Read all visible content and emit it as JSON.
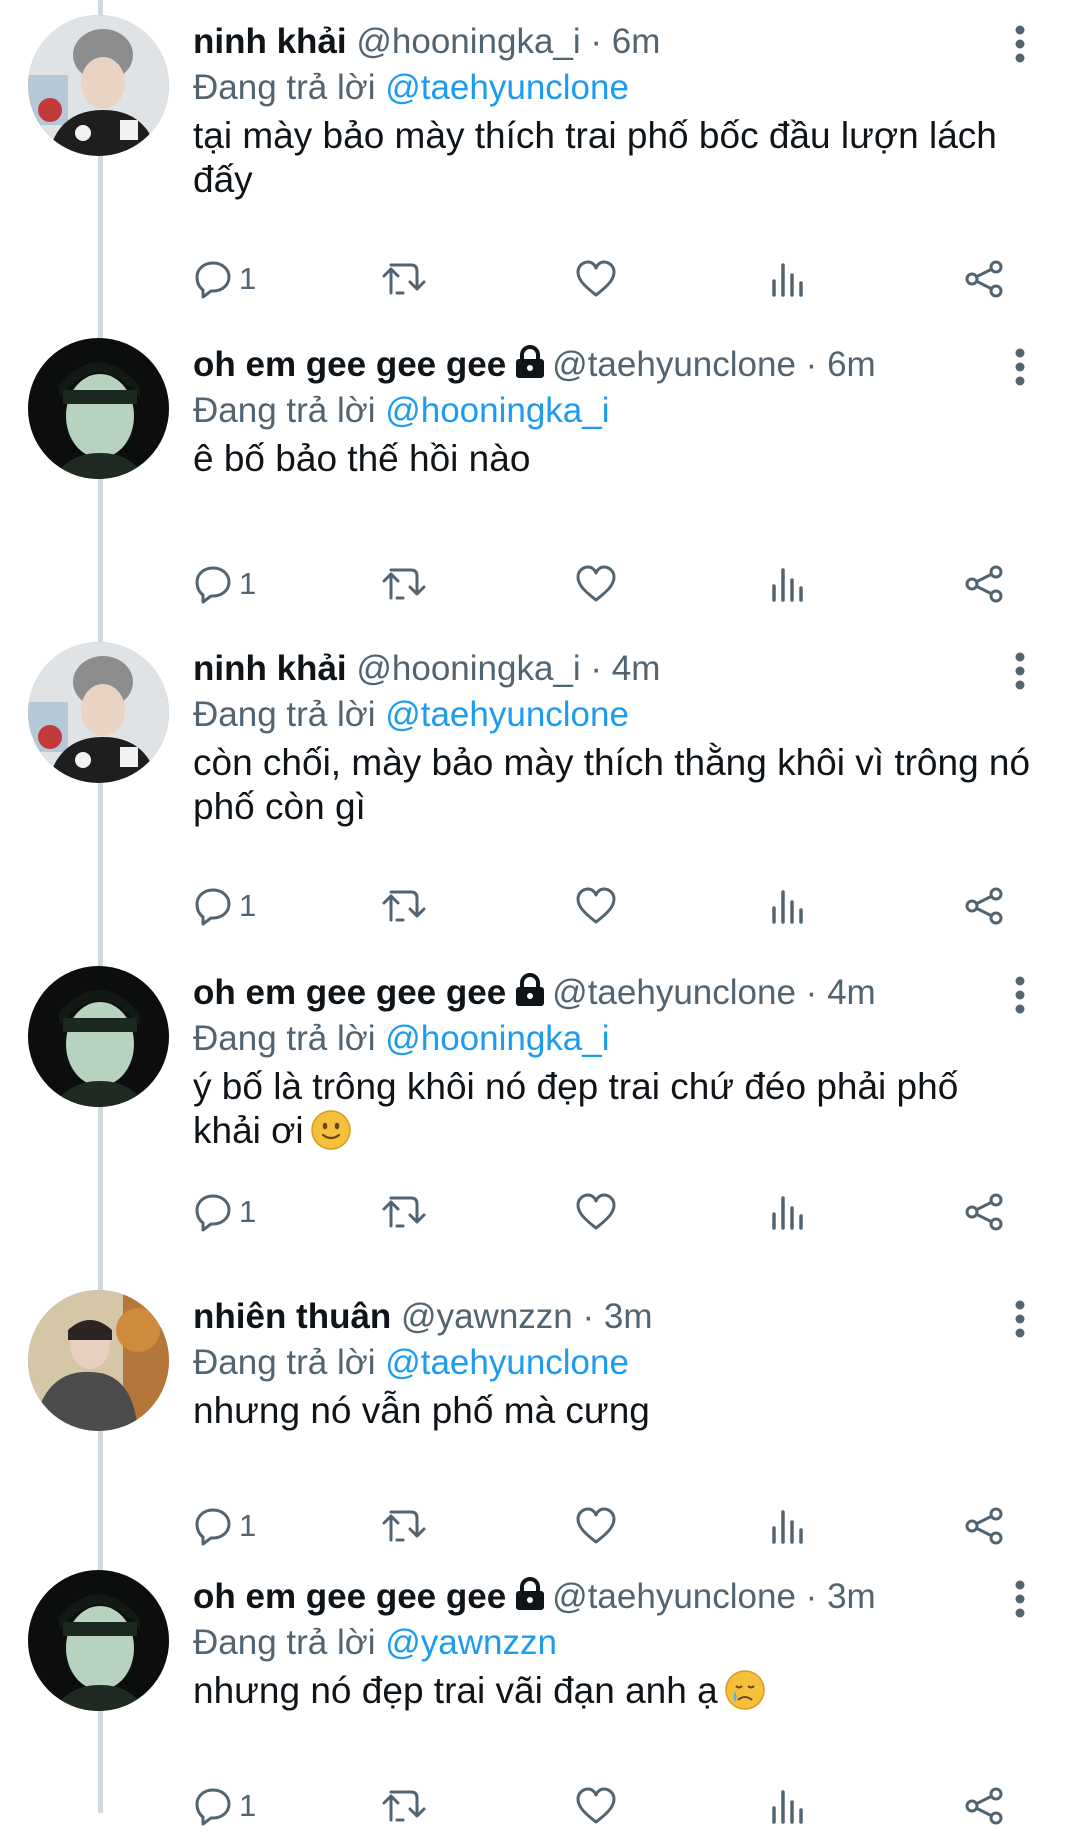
{
  "reply_prefix": "Đang trả lời",
  "separator": "·",
  "colors": {
    "link": "#1d9bf0",
    "muted": "#536471",
    "text": "#0f1419",
    "thread_line": "#cfd9de"
  },
  "tweets": [
    {
      "name": "ninh khải",
      "locked": false,
      "handle": "@hooningka_i",
      "time": "6m",
      "reply_to": "@taehyunclone",
      "text": "tại mày bảo mày thích trai phố bốc đầu lượn lách đấy",
      "emoji": "",
      "replies": "1"
    },
    {
      "name": "oh em gee gee gee",
      "locked": true,
      "handle": "@taehyunclone",
      "time": "6m",
      "reply_to": "@hooningka_i",
      "text": "ê bố bảo thế hồi nào",
      "emoji": "",
      "replies": "1"
    },
    {
      "name": "ninh khải",
      "locked": false,
      "handle": "@hooningka_i",
      "time": "4m",
      "reply_to": "@taehyunclone",
      "text": "còn chối, mày bảo mày thích thằng khôi vì trông nó phố còn gì",
      "emoji": "",
      "replies": "1"
    },
    {
      "name": "oh em gee gee gee",
      "locked": true,
      "handle": "@taehyunclone",
      "time": "4m",
      "reply_to": "@hooningka_i",
      "text": "ý bố là trông khôi nó đẹp trai chứ đéo phải phố khải ơi",
      "emoji": "slightly-smiling-face",
      "replies": "1"
    },
    {
      "name": "nhiên thuân",
      "locked": false,
      "handle": "@yawnzzn",
      "time": "3m",
      "reply_to": "@taehyunclone",
      "text": "nhưng nó vẫn phố mà cưng",
      "emoji": "",
      "replies": "1"
    },
    {
      "name": "oh em gee gee gee",
      "locked": true,
      "handle": "@taehyunclone",
      "time": "3m",
      "reply_to": "@yawnzzn",
      "text": "nhưng nó đẹp trai vãi đạn anh ạ",
      "emoji": "crying-face",
      "replies": "1"
    }
  ]
}
